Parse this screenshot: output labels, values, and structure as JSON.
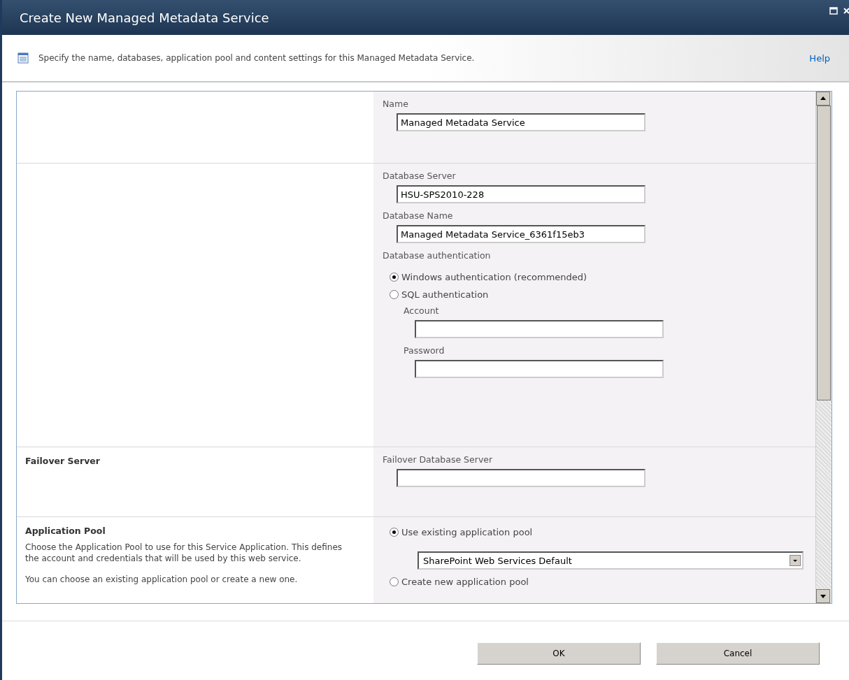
{
  "window": {
    "title": "Create New Managed Metadata Service"
  },
  "description": {
    "text": "Specify the name, databases, application pool and content settings for this Managed Metadata Service.",
    "help_link": "Help"
  },
  "sections": [
    {
      "fields": [
        {
          "kind": "input",
          "label": "Name",
          "value": "Managed Metadata Service"
        }
      ]
    },
    {
      "fields": [
        {
          "kind": "input",
          "label": "Database Server",
          "value": "HSU-SPS2010-228"
        },
        {
          "kind": "input",
          "label": "Database Name",
          "value": "Managed Metadata Service_6361f15eb3"
        },
        {
          "kind": "radio_group",
          "label": "Database authentication",
          "options": [
            {
              "label": "Windows authentication (recommended)",
              "selected": true
            },
            {
              "label": "SQL authentication",
              "selected": false,
              "fields": [
                {
                  "kind": "input",
                  "label": "Account"
                },
                {
                  "kind": "input",
                  "label": "Password"
                }
              ]
            }
          ]
        }
      ]
    },
    {
      "heading": "Failover Server",
      "fields": [
        {
          "kind": "input",
          "label": "Failover Database Server"
        }
      ]
    },
    {
      "heading": "Application Pool",
      "paragraphs": [
        "Choose the Application Pool to use for this Service Application. This defines the account and credentials that will be used by this web service.",
        "You can choose an existing application pool or create a new one."
      ],
      "fields": [
        {
          "kind": "radio_group",
          "options": [
            {
              "label": "Use existing application pool",
              "selected": true,
              "fields": [
                {
                  "kind": "select",
                  "value": "SharePoint Web Services Default"
                }
              ]
            },
            {
              "label": "Create new application pool",
              "selected": false
            }
          ]
        }
      ]
    }
  ],
  "buttons": [
    "OK",
    "Cancel"
  ]
}
